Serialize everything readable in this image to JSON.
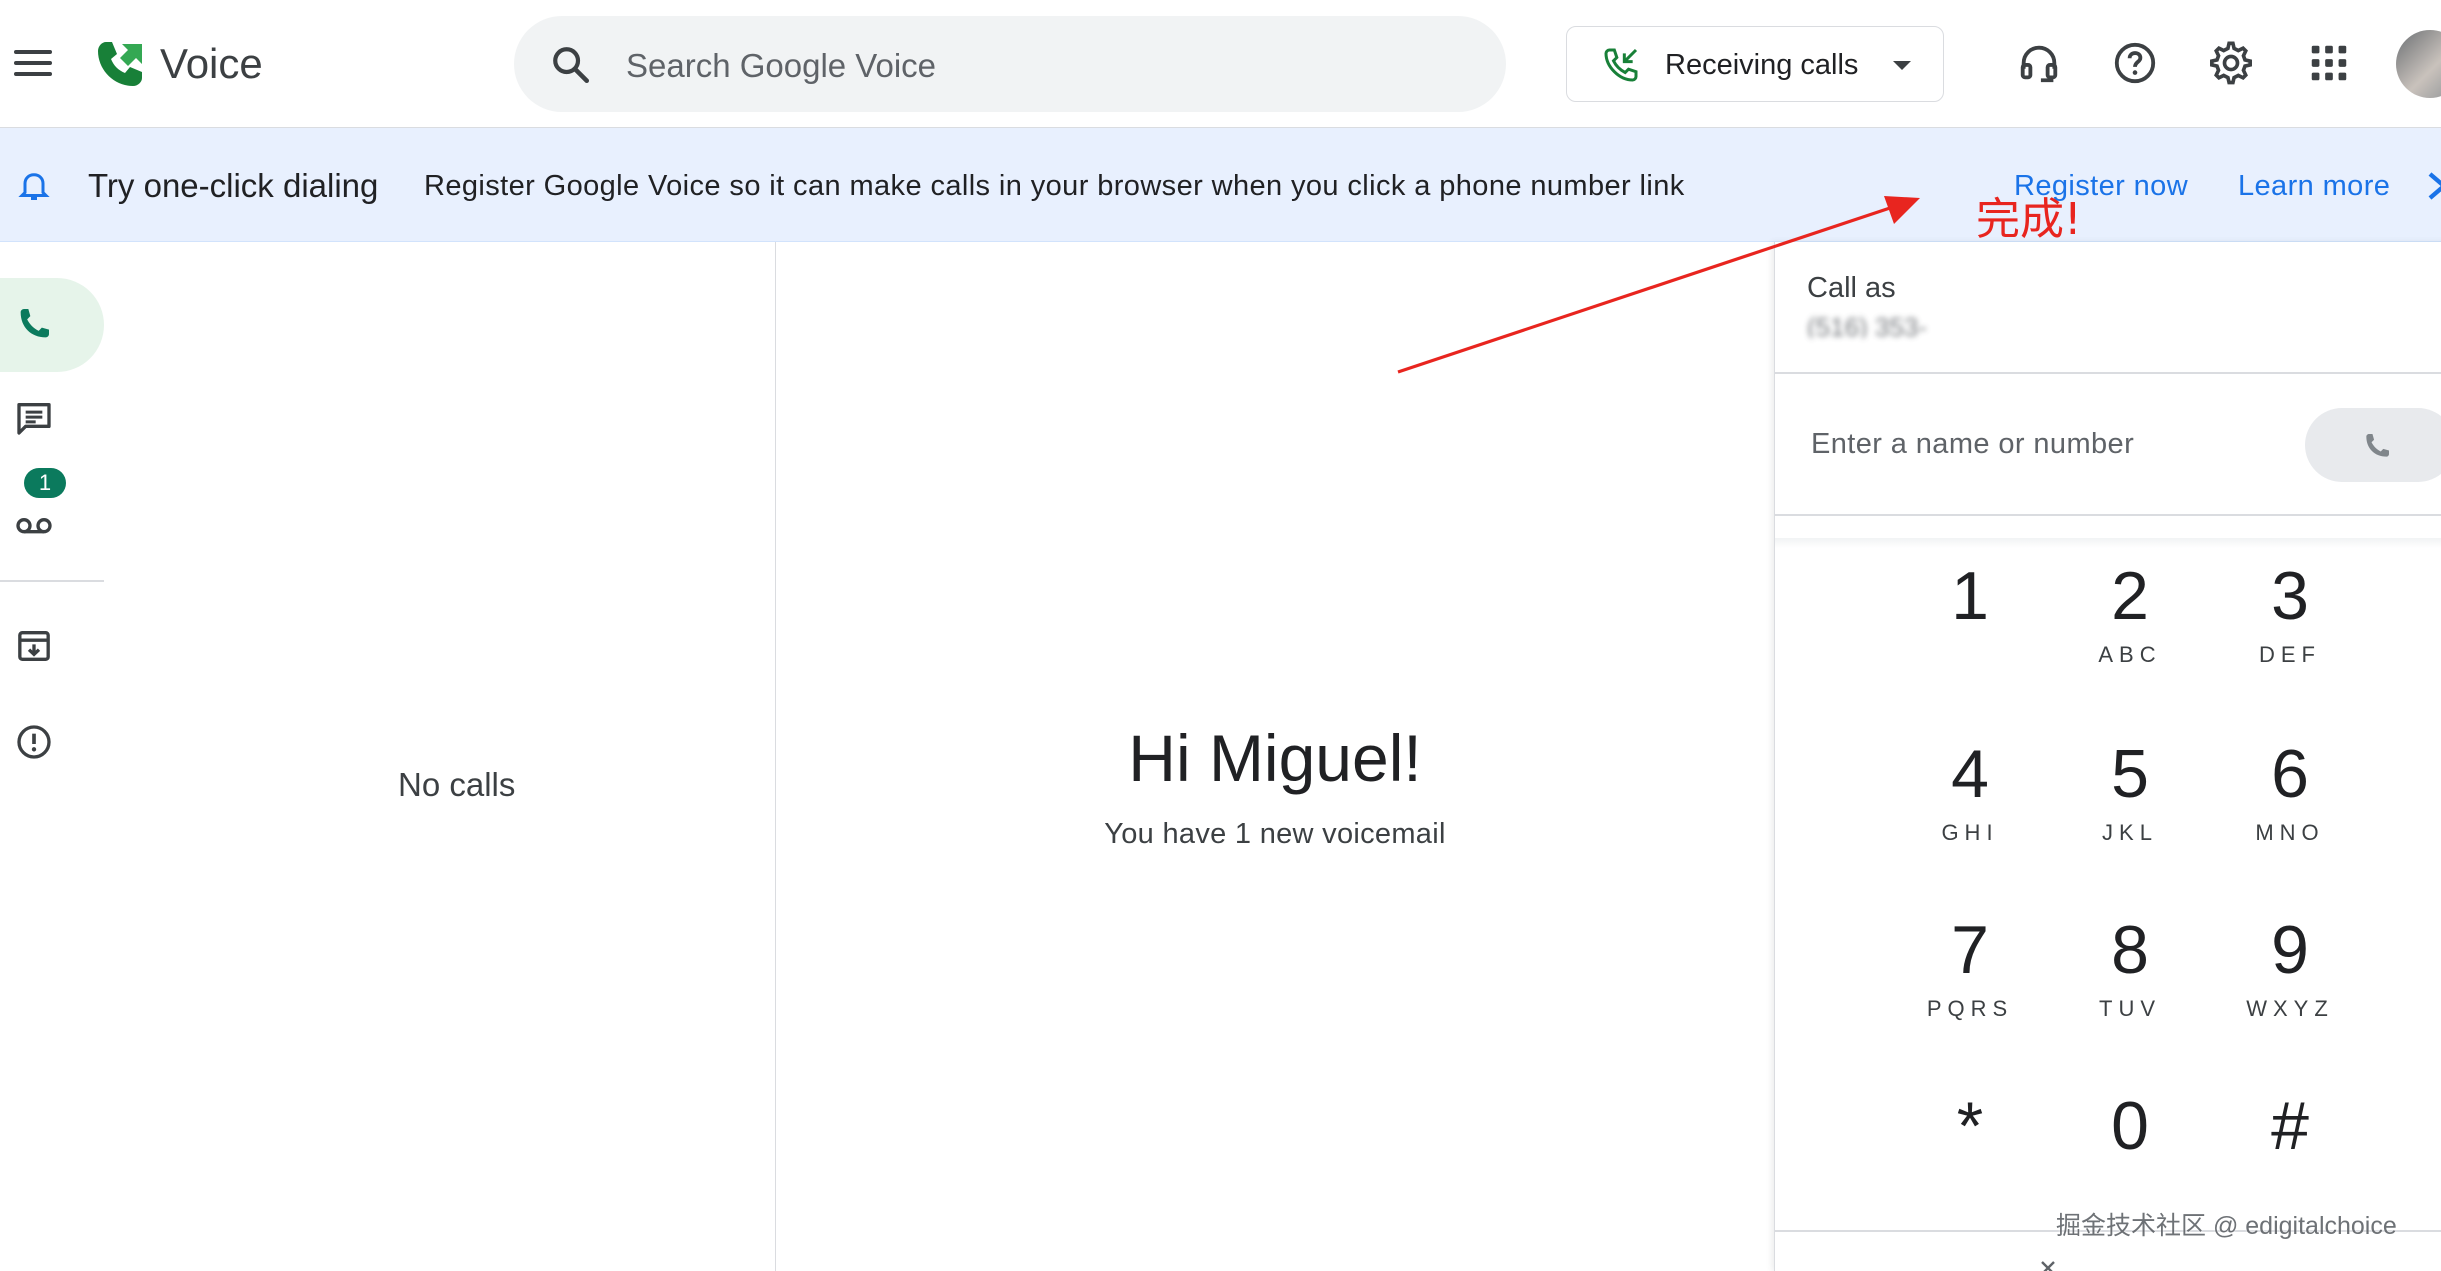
{
  "app": {
    "title": "Voice"
  },
  "search": {
    "placeholder": "Search Google Voice"
  },
  "status": {
    "label": "Receiving calls"
  },
  "topbar_icons": [
    "headset-icon",
    "help-icon",
    "settings-icon",
    "apps-grid-icon"
  ],
  "banner": {
    "title": "Try one-click dialing",
    "description": "Register Google Voice so it can make calls in your browser when you click a phone number link",
    "register_label": "Register now",
    "learn_label": "Learn more"
  },
  "rail": {
    "items": [
      "calls",
      "messages",
      "voicemail",
      "archive",
      "spam"
    ],
    "voicemail_badge": "1"
  },
  "list": {
    "empty_text": "No calls"
  },
  "greeting": {
    "title": "Hi Miguel!",
    "subtitle": "You have 1 new voicemail"
  },
  "dialer": {
    "call_as_label": "Call as",
    "call_as_number": "(516) 353-",
    "input_placeholder": "Enter a name or number",
    "keys": [
      {
        "digit": "1",
        "letters": ""
      },
      {
        "digit": "2",
        "letters": "ABC"
      },
      {
        "digit": "3",
        "letters": "DEF"
      },
      {
        "digit": "4",
        "letters": "GHI"
      },
      {
        "digit": "5",
        "letters": "JKL"
      },
      {
        "digit": "6",
        "letters": "MNO"
      },
      {
        "digit": "7",
        "letters": "PQRS"
      },
      {
        "digit": "8",
        "letters": "TUV"
      },
      {
        "digit": "9",
        "letters": "WXYZ"
      },
      {
        "digit": "*",
        "letters": ""
      },
      {
        "digit": "0",
        "letters": ""
      },
      {
        "digit": "#",
        "letters": ""
      }
    ]
  },
  "annotation": {
    "text": "完成!",
    "color": "#e8251f"
  },
  "watermark": {
    "text": "掘金技术社区 @ edigitalchoice"
  },
  "colors": {
    "accent": "#1a73e8",
    "brand_green": "#188038",
    "badge": "#0b7a5d",
    "banner_bg": "#e8f0fe"
  }
}
